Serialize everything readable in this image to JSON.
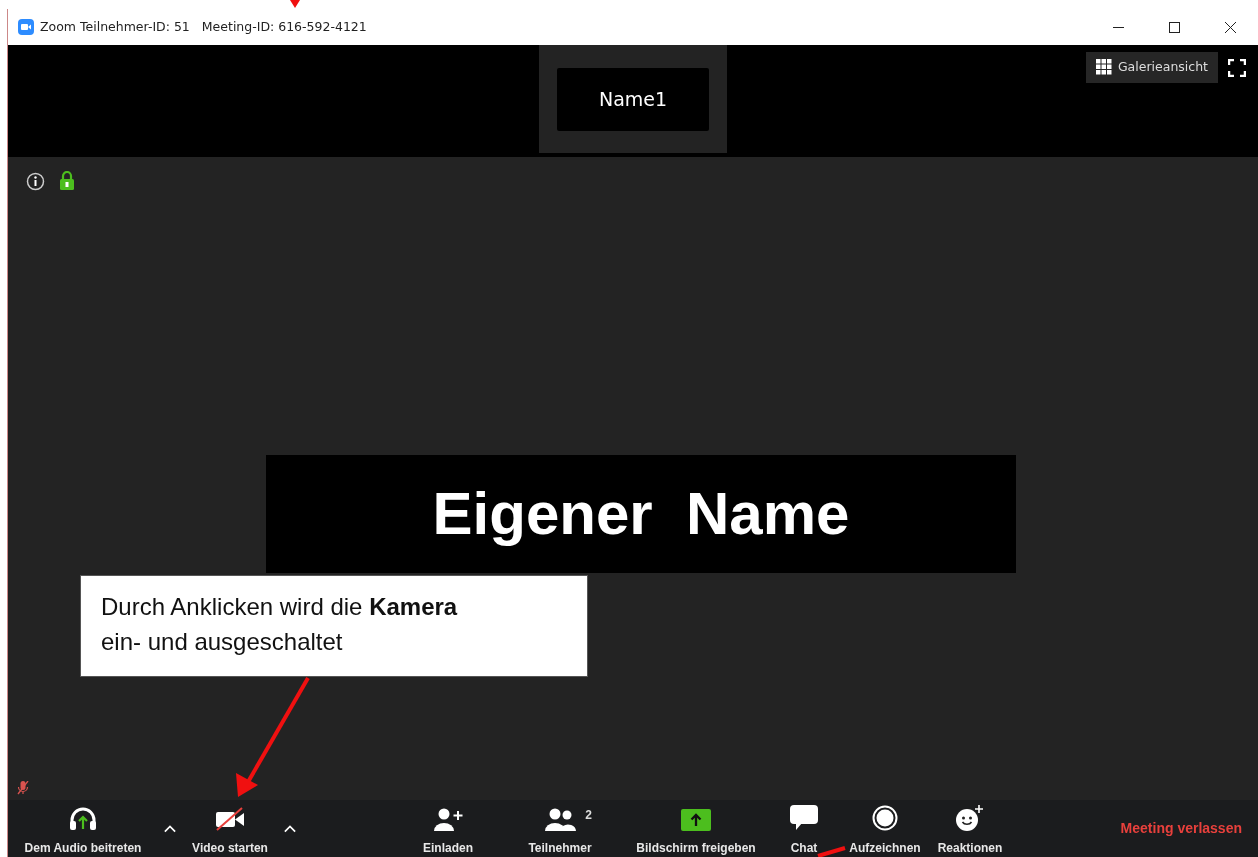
{
  "window": {
    "title_parts": [
      "Zoom Teilnehmer-ID: 51",
      "Meeting-ID: 616-592-4121"
    ]
  },
  "top_strip": {
    "speaker_name": "Name1",
    "view_button": "Galerieansicht"
  },
  "main": {
    "own_name": "Eigener  Name",
    "callout": "Durch Anklicken wird die **Kamera** ein- und ausgeschaltet"
  },
  "toolbar": [
    {
      "kind": "audio",
      "label": "Dem Audio beitreten"
    },
    {
      "kind": "caret"
    },
    {
      "kind": "video",
      "label": "Video starten",
      "muted": true
    },
    {
      "kind": "caret"
    },
    {
      "kind": "invite",
      "label": "Einladen"
    },
    {
      "kind": "participants",
      "label": "Teilnehmer",
      "count": "2"
    },
    {
      "kind": "share",
      "label": "Bildschirm freigeben"
    },
    {
      "kind": "chat",
      "label": "Chat"
    },
    {
      "kind": "record",
      "label": "Aufzeichnen"
    },
    {
      "kind": "reactions",
      "label": "Reaktionen"
    },
    {
      "kind": "leave",
      "label": "Meeting verlassen"
    }
  ]
}
